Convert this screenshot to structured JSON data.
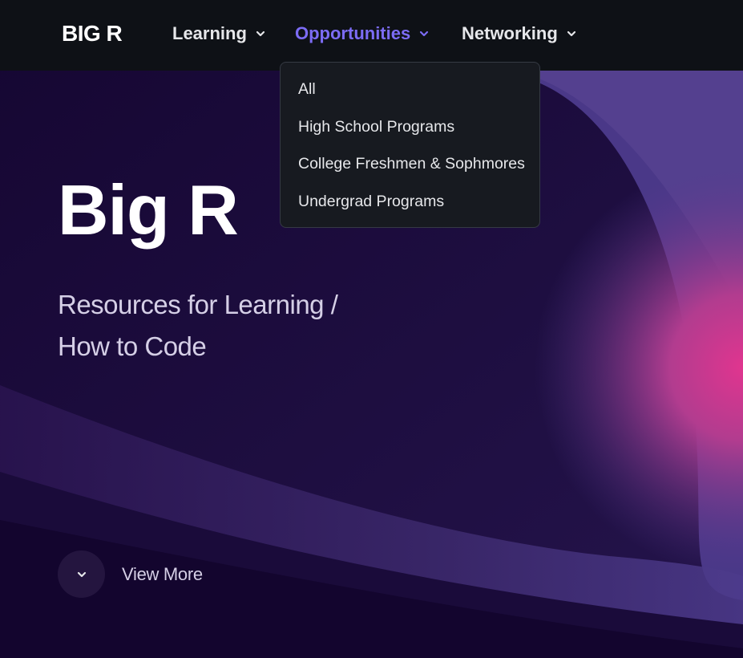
{
  "brand": "BIG R",
  "nav": {
    "items": [
      {
        "label": "Learning",
        "active": false
      },
      {
        "label": "Opportunities",
        "active": true
      },
      {
        "label": "Networking",
        "active": false
      }
    ]
  },
  "dropdown": {
    "items": [
      "All",
      "High School Programs",
      "College Freshmen & Sophmores",
      "Undergrad Programs"
    ]
  },
  "hero": {
    "title": "Big R",
    "subtitle_line1": "Resources for Learning /",
    "subtitle_line2": "How to Code",
    "cta_label": "View More"
  },
  "colors": {
    "nav_bg": "#0e1116",
    "accent": "#7c6cf5",
    "hero_bg": "#13052e",
    "dropdown_bg": "#171a20"
  },
  "icons": {
    "nav_chevron": "chevron-down-icon",
    "cta": "chevron-down-icon"
  }
}
